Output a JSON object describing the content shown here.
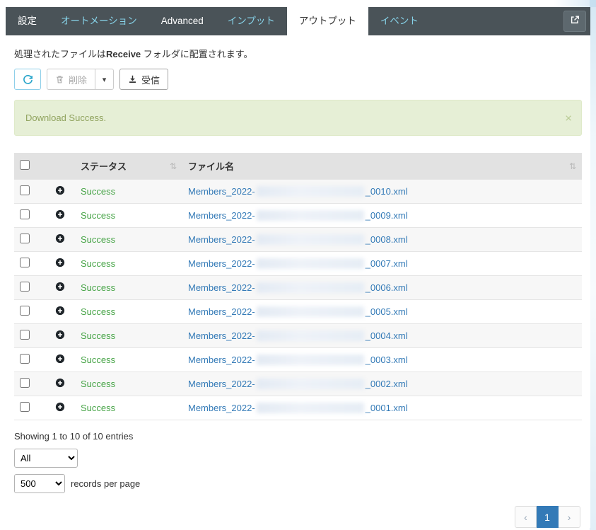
{
  "tabs": [
    {
      "label": "設定"
    },
    {
      "label": "オートメーション"
    },
    {
      "label": "Advanced"
    },
    {
      "label": "インプット"
    },
    {
      "label": "アウトプット",
      "active": true
    },
    {
      "label": "イベント"
    }
  ],
  "description": {
    "prefix": "処理されたファイルは",
    "bold": "Receive",
    "suffix": " フォルダに配置されます。"
  },
  "toolbar": {
    "delete_label": "削除",
    "caret_icon": "▾",
    "receive_label": "受信"
  },
  "alert": {
    "message": "Download Success.",
    "close_icon": "×"
  },
  "table": {
    "status_header": "ステータス",
    "filename_header": "ファイル名",
    "sort_icon": "⇅",
    "rows": [
      {
        "status": "Success",
        "file_prefix": "Members_2022-",
        "file_suffix": "_0010.xml"
      },
      {
        "status": "Success",
        "file_prefix": "Members_2022-",
        "file_suffix": "_0009.xml"
      },
      {
        "status": "Success",
        "file_prefix": "Members_2022-",
        "file_suffix": "_0008.xml"
      },
      {
        "status": "Success",
        "file_prefix": "Members_2022-",
        "file_suffix": "_0007.xml"
      },
      {
        "status": "Success",
        "file_prefix": "Members_2022-",
        "file_suffix": "_0006.xml"
      },
      {
        "status": "Success",
        "file_prefix": "Members_2022-",
        "file_suffix": "_0005.xml"
      },
      {
        "status": "Success",
        "file_prefix": "Members_2022-",
        "file_suffix": "_0004.xml"
      },
      {
        "status": "Success",
        "file_prefix": "Members_2022-",
        "file_suffix": "_0003.xml"
      },
      {
        "status": "Success",
        "file_prefix": "Members_2022-",
        "file_suffix": "_0002.xml"
      },
      {
        "status": "Success",
        "file_prefix": "Members_2022-",
        "file_suffix": "_0001.xml"
      }
    ]
  },
  "footer": {
    "showing": "Showing 1 to 10 of 10 entries",
    "page_select_value": "All",
    "records_select_value": "500",
    "records_label": "records per page",
    "pagination": {
      "prev": "‹",
      "current": "1",
      "next": "›"
    }
  },
  "colors": {
    "tabbar_bg": "#4a5358",
    "tab_link": "#86d2e8",
    "success_text": "#47a447",
    "link": "#337ab7",
    "alert_bg": "#e6efd6",
    "active_page_bg": "#337ab7"
  }
}
